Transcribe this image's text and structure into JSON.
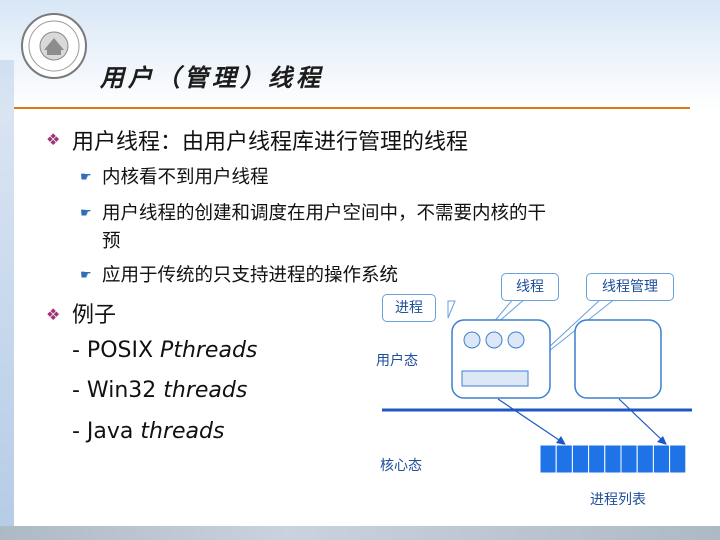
{
  "title": "用户（管理）线程",
  "bullets": {
    "b1": "用户线程：由用户线程库进行管理的线程",
    "b1_sub": [
      "内核看不到用户线程",
      "用户线程的创建和调度在用户空间中，不需要内核的干",
      "预",
      "应用于传统的只支持进程的操作系统"
    ],
    "b2": "例子",
    "examples": [
      {
        "plain": "- POSIX ",
        "italic": "Pthreads"
      },
      {
        "plain": "- Win32 ",
        "italic": "threads"
      },
      {
        "plain": "- Java ",
        "italic": "threads"
      }
    ]
  },
  "diagram": {
    "thread_label": "线程",
    "thread_mgmt_label": "线程管理",
    "process_label": "进程",
    "user_mode_label": "用户态",
    "kernel_mode_label": "核心态",
    "process_table_label": "进程列表",
    "process_table_cells": 9
  },
  "colors": {
    "title_rule": "#e0761a",
    "diagram_text": "#1f4f9a",
    "box_border": "#3d7fd1",
    "mode_line": "#1f57c7",
    "table_fill": "#1e74e6",
    "bullet_diamond": "#a0337a"
  },
  "icons": {
    "bullet_level1": "diamond-bullet-icon",
    "bullet_level2": "pointing-hand-icon",
    "logo": "university-seal-logo"
  }
}
